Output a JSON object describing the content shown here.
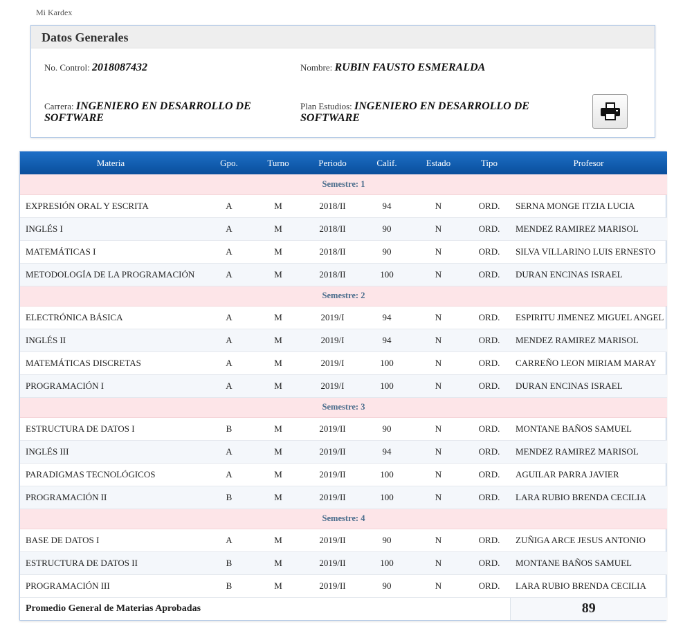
{
  "page": {
    "title": "Mi Kardex"
  },
  "info": {
    "header": "Datos Generales",
    "control_label": "No. Control:",
    "control_value": "2018087432",
    "nombre_label": "Nombre:",
    "nombre_value": "RUBIN FAUSTO ESMERALDA",
    "carrera_label": "Carrera:",
    "carrera_value": "INGENIERO EN DESARROLLO DE SOFTWARE",
    "plan_label": "Plan Estudios:",
    "plan_value": "INGENIERO EN DESARROLLO DE SOFTWARE",
    "print_icon": "printer-icon"
  },
  "table": {
    "headers": [
      "Materia",
      "Gpo.",
      "Turno",
      "Periodo",
      "Calif.",
      "Estado",
      "Tipo",
      "Profesor"
    ],
    "semesters": [
      {
        "label": "Semestre: 1",
        "rows": [
          [
            "EXPRESIÓN ORAL Y ESCRITA",
            "A",
            "M",
            "2018/II",
            "94",
            "N",
            "ORD.",
            "SERNA MONGE ITZIA LUCIA"
          ],
          [
            "INGLÉS I",
            "A",
            "M",
            "2018/II",
            "90",
            "N",
            "ORD.",
            "MENDEZ RAMIREZ MARISOL"
          ],
          [
            "MATEMÁTICAS I",
            "A",
            "M",
            "2018/II",
            "90",
            "N",
            "ORD.",
            "SILVA VILLARINO LUIS ERNESTO"
          ],
          [
            "METODOLOGÍA DE LA PROGRAMACIÓN",
            "A",
            "M",
            "2018/II",
            "100",
            "N",
            "ORD.",
            "DURAN ENCINAS ISRAEL"
          ]
        ]
      },
      {
        "label": "Semestre: 2",
        "rows": [
          [
            "ELECTRÓNICA BÁSICA",
            "A",
            "M",
            "2019/I",
            "94",
            "N",
            "ORD.",
            "ESPIRITU JIMENEZ MIGUEL ANGEL"
          ],
          [
            "INGLÉS II",
            "A",
            "M",
            "2019/I",
            "94",
            "N",
            "ORD.",
            "MENDEZ RAMIREZ MARISOL"
          ],
          [
            "MATEMÁTICAS DISCRETAS",
            "A",
            "M",
            "2019/I",
            "100",
            "N",
            "ORD.",
            "CARREÑO LEON MIRIAM MARAY"
          ],
          [
            "PROGRAMACIÓN I",
            "A",
            "M",
            "2019/I",
            "100",
            "N",
            "ORD.",
            "DURAN ENCINAS ISRAEL"
          ]
        ]
      },
      {
        "label": "Semestre: 3",
        "rows": [
          [
            "ESTRUCTURA DE DATOS I",
            "B",
            "M",
            "2019/II",
            "90",
            "N",
            "ORD.",
            "MONTANE BAÑOS SAMUEL"
          ],
          [
            "INGLÉS III",
            "A",
            "M",
            "2019/II",
            "94",
            "N",
            "ORD.",
            "MENDEZ RAMIREZ MARISOL"
          ],
          [
            "PARADIGMAS TECNOLÓGICOS",
            "A",
            "M",
            "2019/II",
            "100",
            "N",
            "ORD.",
            "AGUILAR PARRA JAVIER"
          ],
          [
            "PROGRAMACIÓN II",
            "B",
            "M",
            "2019/II",
            "100",
            "N",
            "ORD.",
            "LARA RUBIO BRENDA CECILIA"
          ]
        ]
      },
      {
        "label": "Semestre: 4",
        "rows": [
          [
            "BASE DE DATOS I",
            "A",
            "M",
            "2019/II",
            "90",
            "N",
            "ORD.",
            "ZUÑIGA ARCE JESUS ANTONIO"
          ],
          [
            "ESTRUCTURA DE DATOS II",
            "B",
            "M",
            "2019/II",
            "100",
            "N",
            "ORD.",
            "MONTANE BAÑOS SAMUEL"
          ],
          [
            "PROGRAMACIÓN III",
            "B",
            "M",
            "2019/II",
            "90",
            "N",
            "ORD.",
            "LARA RUBIO BRENDA CECILIA"
          ]
        ]
      }
    ],
    "footer": {
      "label": "Promedio General de Materias Aprobadas",
      "average": "89"
    }
  },
  "colors": {
    "header_blue": "#0a4f9c",
    "semester_bg": "#fde5e8",
    "semester_text": "#4a6d8c",
    "panel_border": "#a9c4e6"
  }
}
